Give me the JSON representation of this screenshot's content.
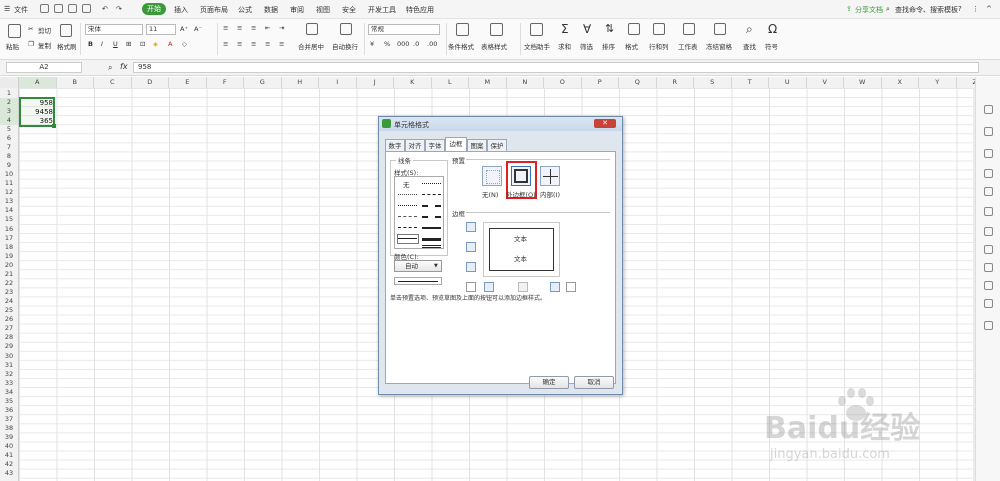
{
  "menubar": {
    "file": "文件",
    "tabs": [
      "开始",
      "插入",
      "页面布局",
      "公式",
      "数据",
      "审阅",
      "视图",
      "安全",
      "开发工具",
      "特色应用"
    ],
    "active_tab": "开始",
    "share": "分享文档",
    "search": "查找命令、搜索模板"
  },
  "ribbon": {
    "paste": "粘贴",
    "cut": "剪切",
    "copy": "复制",
    "format_painter": "格式刷",
    "font": "宋体",
    "font_size": "11",
    "merge": "合并居中",
    "wrap": "自动换行",
    "number_format": "常规",
    "conditional": "条件格式",
    "table_style": "表格样式",
    "doc_helper": "文档助手",
    "sum": "求和",
    "filter": "筛选",
    "sort": "排序",
    "format": "格式",
    "rowcol": "行和列",
    "worksheet": "工作表",
    "freeze": "冻结窗格",
    "find": "查找",
    "symbol": "符号"
  },
  "formula_bar": {
    "cell_ref": "A2",
    "fx": "fx",
    "value": "958"
  },
  "sheet": {
    "columns": [
      "A",
      "B",
      "C",
      "D",
      "E",
      "F",
      "G",
      "H",
      "I",
      "J",
      "K",
      "L",
      "M",
      "N",
      "O",
      "P",
      "Q",
      "R",
      "S",
      "T",
      "U",
      "V",
      "W",
      "X",
      "Y",
      "Z"
    ],
    "rows": [
      "1",
      "2",
      "3",
      "4",
      "5",
      "6",
      "7",
      "8",
      "9",
      "10",
      "11",
      "12",
      "13",
      "14",
      "15",
      "16",
      "17",
      "18",
      "19",
      "20",
      "21",
      "22",
      "23",
      "24",
      "25",
      "26",
      "27",
      "28",
      "29",
      "30",
      "31",
      "32",
      "33",
      "34",
      "35",
      "36",
      "37",
      "38",
      "39",
      "40",
      "41",
      "42",
      "43"
    ],
    "cells": {
      "A2": "958",
      "A3": "9458",
      "A4": "365"
    }
  },
  "dialog": {
    "title": "单元格格式",
    "tabs": [
      "数字",
      "对齐",
      "字体",
      "边框",
      "图案",
      "保护"
    ],
    "active_tab": "边框",
    "line_group": "线条",
    "style_label": "样式(S):",
    "none_style": "无",
    "color_label": "颜色(C):",
    "color_value": "自动",
    "preset_group": "预置",
    "preset_none": "无(N)",
    "preset_outline": "外边框(O)",
    "preset_inside": "内部(I)",
    "border_group": "边框",
    "preview_text_1": "文本",
    "preview_text_2": "文本",
    "hint": "单击预置选项、预览草图及上面的按钮可以添加边框样式。",
    "ok": "确定",
    "cancel": "取消",
    "highlight_color": "#e02020"
  },
  "watermark": {
    "brand": "Baidu经验",
    "url": "jingyan.baidu.com"
  },
  "colors": {
    "accent": "#3a9a3a",
    "selection": "#2e8b3a"
  }
}
